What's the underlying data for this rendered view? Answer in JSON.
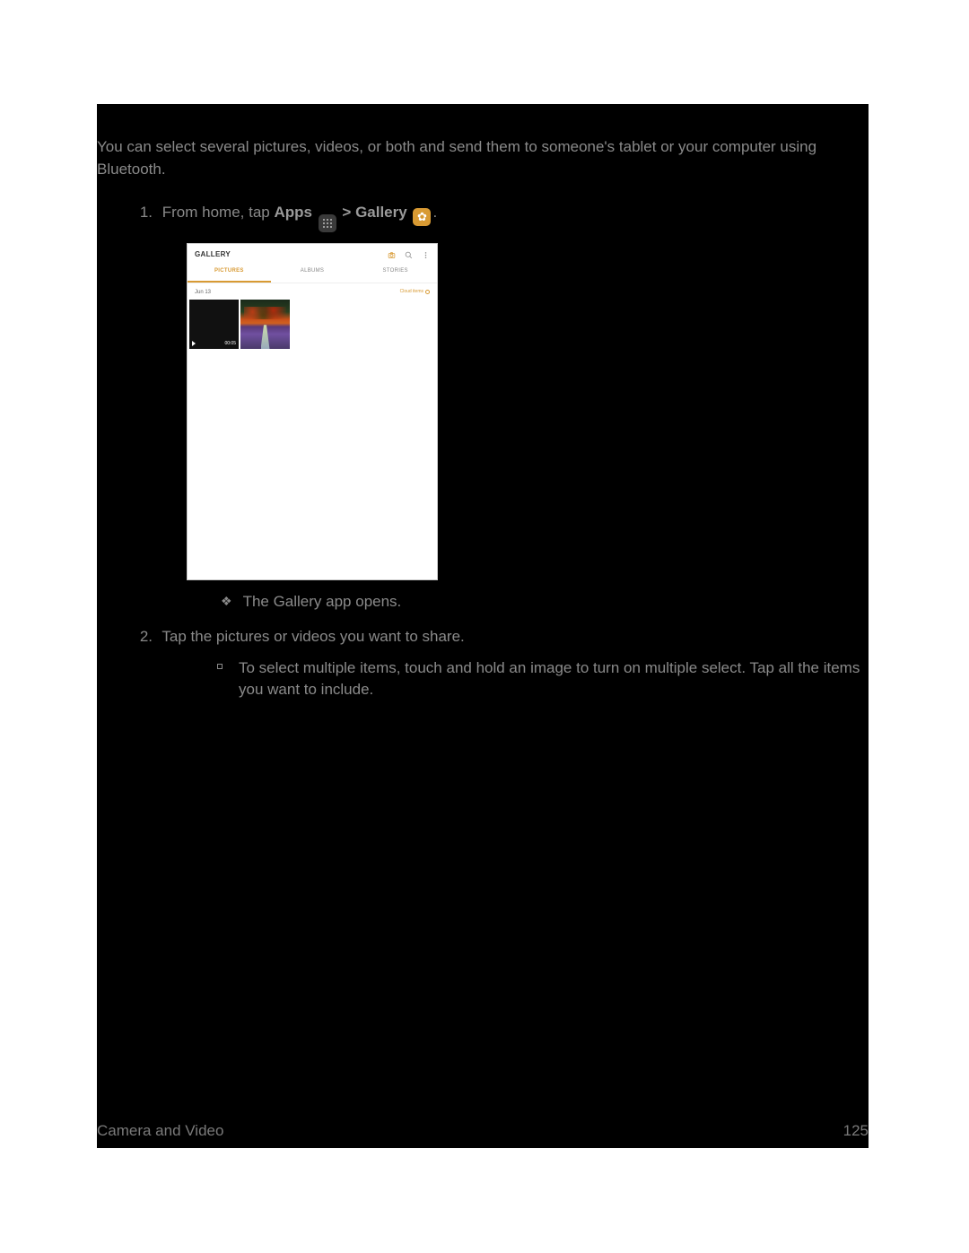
{
  "intro": "You can select several pictures, videos, or both and send them to someone's tablet or your computer using Bluetooth.",
  "steps": {
    "s1": {
      "num": "1.",
      "pre": "From home, tap ",
      "apps": "Apps",
      "sep": " > ",
      "gallery": "Gallery",
      "end": "."
    },
    "s1_sub": "The Gallery app opens.",
    "s2": {
      "num": "2.",
      "text": "Tap the pictures or videos you want to share."
    },
    "s2_sub": "To select multiple items, touch and hold an image to turn on multiple select. Tap all the items you want to include."
  },
  "screenshot": {
    "title": "GALLERY",
    "tabs": {
      "pictures": "PICTURES",
      "albums": "ALBUMS",
      "stories": "STORIES"
    },
    "date": "Jun 13",
    "cloud": "Cloud items",
    "duration": "00:05"
  },
  "footer": {
    "section": "Camera and Video",
    "page": "125"
  }
}
